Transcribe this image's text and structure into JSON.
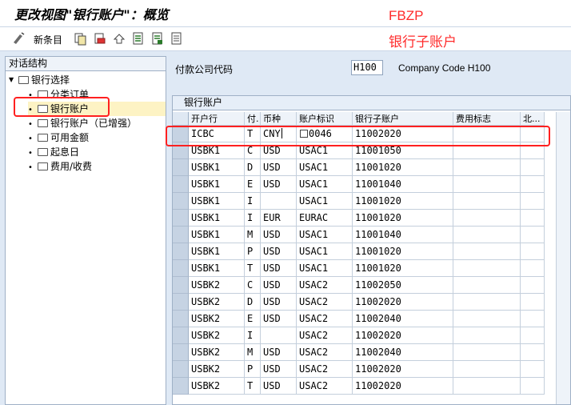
{
  "window": {
    "title": "更改视图\"银行账户\"：概览"
  },
  "toolbar": {
    "new_entries_label": "新条目"
  },
  "annotations": {
    "tcode": "FBZP",
    "subtitle": "银行子账户"
  },
  "nav": {
    "header": "对话结构",
    "root": "银行选择",
    "items": [
      {
        "label": "分类订单"
      },
      {
        "label": "银行账户",
        "selected": true
      },
      {
        "label": "银行账户（已增强）"
      },
      {
        "label": "可用金额"
      },
      {
        "label": "起息日"
      },
      {
        "label": "费用/收费"
      }
    ]
  },
  "company_code": {
    "label": "付款公司代码",
    "value": "H100",
    "description": "Company Code H100"
  },
  "table": {
    "caption": "银行账户",
    "columns": [
      "开户行",
      "付.",
      "币种",
      "账户标识",
      "银行子账户",
      "费用标志",
      "北..."
    ],
    "rows": [
      [
        "ICBC",
        "T",
        "CNY",
        "0046",
        "11002020"
      ],
      [
        "USBK1",
        "C",
        "USD",
        "USAC1",
        "11001050"
      ],
      [
        "USBK1",
        "D",
        "USD",
        "USAC1",
        "11001020"
      ],
      [
        "USBK1",
        "E",
        "USD",
        "USAC1",
        "11001040"
      ],
      [
        "USBK1",
        "I",
        "",
        "USAC1",
        "11001020"
      ],
      [
        "USBK1",
        "I",
        "EUR",
        "EURAC",
        "11001020"
      ],
      [
        "USBK1",
        "M",
        "USD",
        "USAC1",
        "11001040"
      ],
      [
        "USBK1",
        "P",
        "USD",
        "USAC1",
        "11001020"
      ],
      [
        "USBK1",
        "T",
        "USD",
        "USAC1",
        "11001020"
      ],
      [
        "USBK2",
        "C",
        "USD",
        "USAC2",
        "11002050"
      ],
      [
        "USBK2",
        "D",
        "USD",
        "USAC2",
        "11002020"
      ],
      [
        "USBK2",
        "E",
        "USD",
        "USAC2",
        "11002040"
      ],
      [
        "USBK2",
        "I",
        "",
        "USAC2",
        "11002020"
      ],
      [
        "USBK2",
        "M",
        "USD",
        "USAC2",
        "11002040"
      ],
      [
        "USBK2",
        "P",
        "USD",
        "USAC2",
        "11002020"
      ],
      [
        "USBK2",
        "T",
        "USD",
        "USAC2",
        "11002020"
      ]
    ]
  },
  "colors": {
    "annotation_red": "#ff2020",
    "selection_yellow": "#fdf3c4"
  }
}
